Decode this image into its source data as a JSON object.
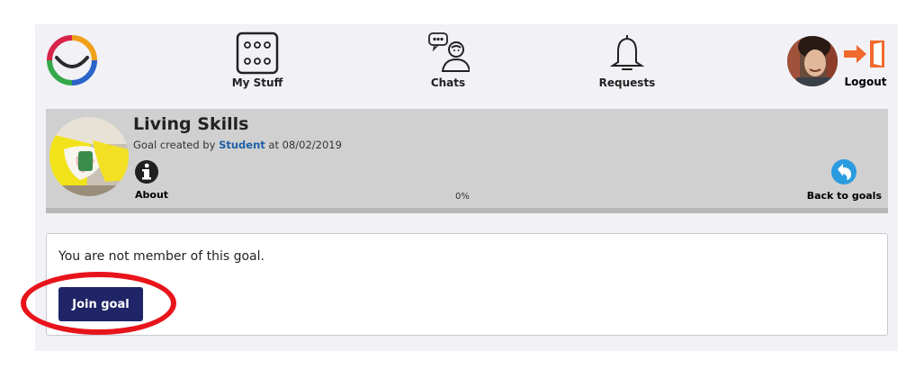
{
  "nav": {
    "my_stuff": "My Stuff",
    "chats": "Chats",
    "requests": "Requests",
    "logout": "Logout"
  },
  "goal": {
    "title": "Living Skills",
    "created_prefix": "Goal created by ",
    "author": "Student",
    "created_suffix": " at 08/02/2019",
    "about_label": "About",
    "back_label": "Back to goals",
    "progress_text": "0%",
    "progress": 0
  },
  "membership": {
    "message": "You are not member of this goal.",
    "join_label": "Join goal"
  },
  "colors": {
    "join_button": "#1f2566",
    "author_link": "#1f5fa8",
    "back_icon": "#2b9be0",
    "logout_arrow": "#f06a2c",
    "highlight": "#e8141b"
  },
  "icons": {
    "logo": "smile-logo-icon",
    "my_stuff": "dice-grid-icon",
    "chats": "chat-person-icon",
    "requests": "bell-icon",
    "logout": "exit-door-icon",
    "about": "info-icon",
    "back": "back-arrow-icon"
  }
}
